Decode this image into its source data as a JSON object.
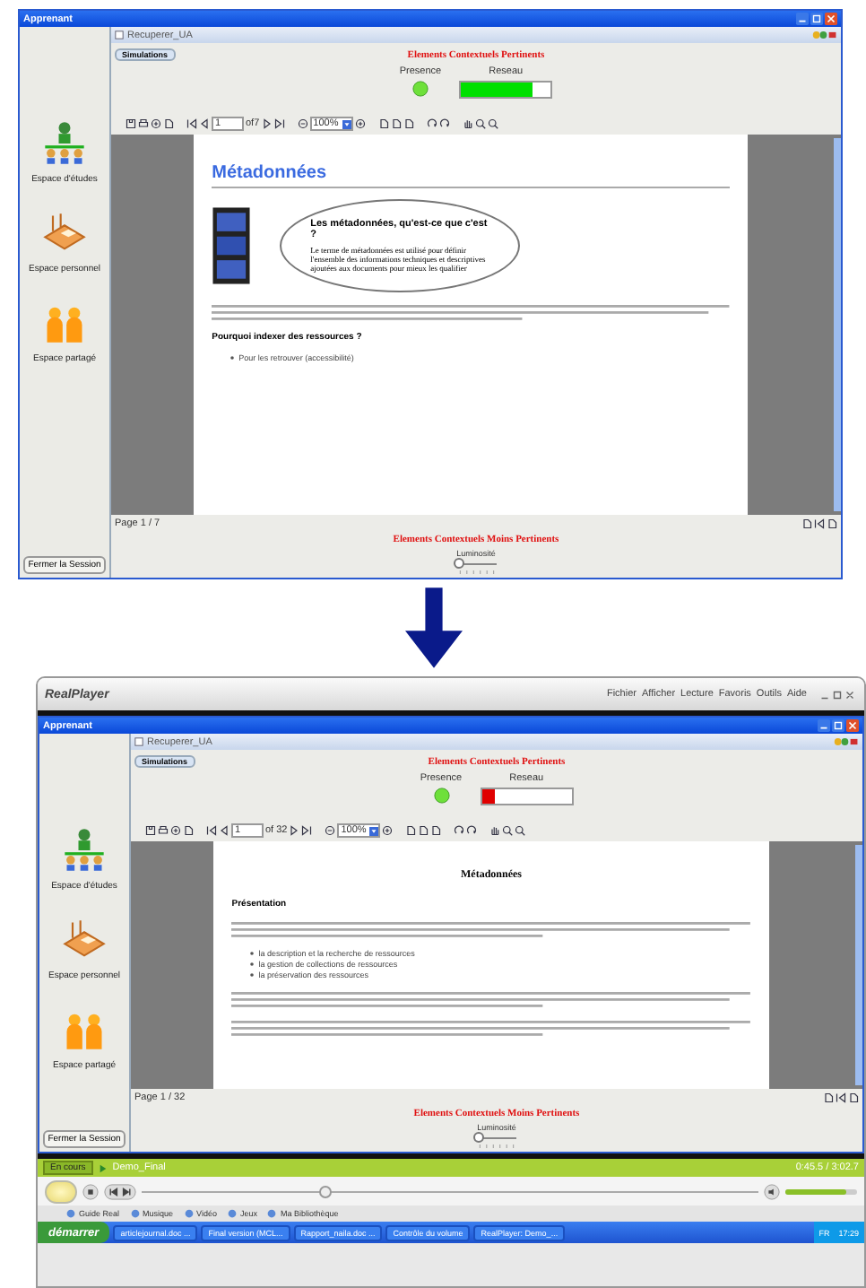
{
  "before": {
    "title": "Apprenant",
    "sidebar": [
      {
        "kind": "study",
        "label": "Espace d'études"
      },
      {
        "kind": "personal",
        "label": "Espace personnel"
      },
      {
        "kind": "shared",
        "label": "Espace partagé"
      }
    ],
    "close_button": "Fermer la Session",
    "panel_title": "Recuperer_UA",
    "tab": "Simulations",
    "top_heading": "Elements Contextuels Pertinents",
    "presence_label": "Presence",
    "network_label": "Reseau",
    "network": {
      "level": 0.8,
      "color": "#00e000"
    },
    "page_input": "1",
    "page_total": "of7",
    "zoom": "100%",
    "document": [
      {
        "kind": "title",
        "text": "Métadonnées"
      },
      {
        "kind": "bubble",
        "title": "Les métadonnées, qu'est-ce que c'est ?",
        "text": "Le terme de métadonnées est utilisé pour définir l'ensemble des informations techniques et descriptives ajoutées aux documents pour mieux les qualifier"
      },
      {
        "kind": "lines"
      },
      {
        "kind": "subheading",
        "text": "Pourquoi indexer des ressources ?"
      },
      {
        "kind": "bullets",
        "items": [
          "Pour les retrouver (accessibilité)"
        ]
      }
    ],
    "page_label": "Page 1 / 7",
    "bottom_heading": "Elements Contextuels Moins Pertinents",
    "brightness_label": "Luminosité",
    "brightness": {
      "level": 0.05
    }
  },
  "after": {
    "player": {
      "logo": "RealPlayer",
      "menu": [
        "Fichier",
        "Afficher",
        "Lecture",
        "Favoris",
        "Outils",
        "Aide"
      ]
    },
    "app": {
      "title": "Apprenant",
      "sidebar": [
        {
          "kind": "study",
          "label": "Espace d'études"
        },
        {
          "kind": "personal",
          "label": "Espace personnel"
        },
        {
          "kind": "shared",
          "label": "Espace partagé"
        }
      ],
      "close_button": "Fermer la Session",
      "panel_title": "Recuperer_UA",
      "tab": "Simulations",
      "top_heading": "Elements Contextuels Pertinents",
      "presence_label": "Presence",
      "network_label": "Reseau",
      "network": {
        "level": 0.15,
        "color": "#e00000"
      },
      "page_input": "1",
      "page_total": "of 32",
      "zoom": "100%",
      "document": [
        {
          "kind": "centered_title",
          "text": "Métadonnées"
        },
        {
          "kind": "subheading",
          "text": "Présentation"
        },
        {
          "kind": "lines"
        },
        {
          "kind": "bullets",
          "items": [
            "la description et la recherche de ressources",
            "la gestion de collections de ressources",
            "la préservation des ressources"
          ]
        },
        {
          "kind": "lines"
        },
        {
          "kind": "lines"
        }
      ],
      "page_label": "Page 1 / 32",
      "bottom_heading": "Elements Contextuels Moins Pertinents",
      "brightness_label": "Luminosité",
      "brightness": {
        "level": 0.05
      }
    },
    "playback": {
      "now_button": "En cours",
      "clip": "Demo_Final",
      "time": "0:45.5 / 3:02.7",
      "position": {
        "level": 0.3
      },
      "volume": {
        "level": 0.85
      },
      "links": [
        "Guide Real",
        "Musique",
        "Vidéo",
        "Jeux",
        "Ma Bibliothèque"
      ]
    },
    "taskbar": {
      "start": "démarrer",
      "tasks": [
        "articlejournal.doc ...",
        "Final version (MCL...",
        "Rapport_naila.doc ...",
        "Contrôle du volume",
        "RealPlayer: Demo_..."
      ],
      "language": "FR",
      "clock": "17:29"
    }
  }
}
